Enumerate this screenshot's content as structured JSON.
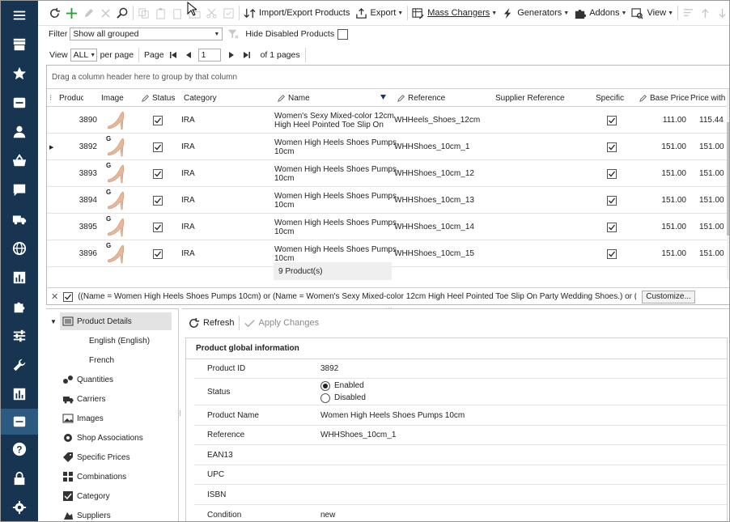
{
  "colors": {
    "sidebar_bg": "#173551",
    "sidebar_active": "#2d5a80",
    "accent_green": "#2e9d3a",
    "check": "#222222"
  },
  "sidebar": {
    "items": [
      "menu-icon",
      "store-icon",
      "star-icon",
      "box-icon",
      "user-icon",
      "basket-icon",
      "message-icon",
      "truck-icon",
      "globe-icon",
      "chart-icon",
      "puzzle-icon",
      "sliders-icon",
      "wrench-icon",
      "report-icon",
      "inbox-icon",
      "help-icon",
      "lock-icon",
      "gear-icon"
    ],
    "active": "inbox-icon"
  },
  "toolbar": {
    "import_export": "Import/Export Products",
    "export": "Export",
    "mass_changers": "Mass Changers",
    "generators": "Generators",
    "addons": "Addons",
    "view": "View"
  },
  "filter": {
    "label": "Filter",
    "value": "Show all grouped",
    "hide_disabled": "Hide Disabled Products"
  },
  "pager": {
    "view_label": "View",
    "view_value": "ALL",
    "per_page": "per page",
    "page_label": "Page",
    "page_value": "1",
    "of_pages": "of 1 pages"
  },
  "grid": {
    "group_hint": "Drag a column header here to group by that column",
    "columns": [
      "Product ID",
      "Image",
      "Status",
      "Category",
      "Name",
      "Reference",
      "Supplier Reference",
      "Specific",
      "Base Price",
      "Price with"
    ],
    "rows": [
      {
        "id": "3890",
        "category": "IRA",
        "name_line1": "Women's Sexy Mixed-color 12cm",
        "name_line2": "High Heel Pointed Toe Slip On",
        "reference": "WHHeels_Shoes_12cm",
        "base_price": "111.00",
        "price_with": "115.44",
        "badge": ""
      },
      {
        "id": "3892",
        "category": "IRA",
        "name_line1": "Women High Heels Shoes Pumps",
        "name_line2": "10cm",
        "reference": "WHHShoes_10cm_1",
        "base_price": "151.00",
        "price_with": "151.00",
        "badge": "G"
      },
      {
        "id": "3893",
        "category": "IRA",
        "name_line1": "Women High Heels Shoes Pumps",
        "name_line2": "10cm",
        "reference": "WHHShoes_10cm_12",
        "base_price": "151.00",
        "price_with": "151.00",
        "badge": "G"
      },
      {
        "id": "3894",
        "category": "IRA",
        "name_line1": "Women High Heels Shoes Pumps",
        "name_line2": "10cm",
        "reference": "WHHShoes_10cm_13",
        "base_price": "151.00",
        "price_with": "151.00",
        "badge": "G"
      },
      {
        "id": "3895",
        "category": "IRA",
        "name_line1": "Women High Heels Shoes Pumps",
        "name_line2": "10cm",
        "reference": "WHHShoes_10cm_14",
        "base_price": "151.00",
        "price_with": "151.00",
        "badge": "G"
      },
      {
        "id": "3896",
        "category": "IRA",
        "name_line1": "Women High Heels Shoes Pumps",
        "name_line2": "10cm",
        "reference": "WHHShoes_10cm_15",
        "base_price": "151.00",
        "price_with": "151.00",
        "badge": "G"
      }
    ],
    "footer": "9 Product(s)",
    "filter_expression": "((Name = Women High Heels Shoes Pumps 10cm) or (Name = Women's Sexy Mixed-color 12cm High Heel Pointed Toe Slip On Party Wedding Shoes.) or (Name = Samsung Gala",
    "customize": "Customize..."
  },
  "tree": {
    "items": [
      {
        "label": "Product Details",
        "icon": "details-icon"
      },
      {
        "label": "English (English)",
        "icon": ""
      },
      {
        "label": "French",
        "icon": ""
      },
      {
        "label": "Quantities",
        "icon": "quantities-icon"
      },
      {
        "label": "Carriers",
        "icon": "truck-icon"
      },
      {
        "label": "Images",
        "icon": "image-icon"
      },
      {
        "label": "Shop Associations",
        "icon": "shop-icon"
      },
      {
        "label": "Specific Prices",
        "icon": "tag-icon"
      },
      {
        "label": "Combinations",
        "icon": "combinations-icon"
      },
      {
        "label": "Category",
        "icon": "category-icon"
      },
      {
        "label": "Suppliers",
        "icon": "suppliers-icon"
      }
    ]
  },
  "detail": {
    "refresh": "Refresh",
    "apply": "Apply Changes",
    "section_title": "Product global information",
    "fields": {
      "product_id_label": "Product ID",
      "product_id": "3892",
      "status_label": "Status",
      "enabled": "Enabled",
      "disabled": "Disabled",
      "name_label": "Product Name",
      "name": "Women High Heels Shoes Pumps 10cm",
      "reference_label": "Reference",
      "reference": "WHHShoes_10cm_1",
      "ean13_label": "EAN13",
      "upc_label": "UPC",
      "isbn_label": "ISBN",
      "condition_label": "Condition",
      "condition": "new"
    }
  }
}
